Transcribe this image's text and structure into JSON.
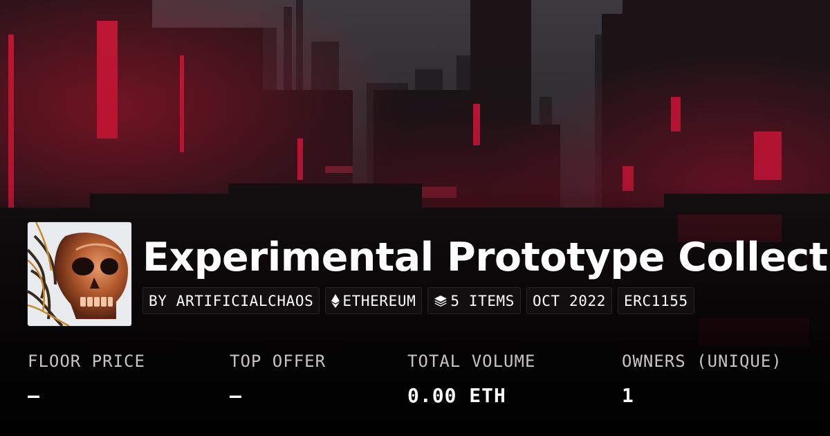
{
  "collection": {
    "title": "Experimental Prototype Collection"
  },
  "tags": [
    {
      "icon": "",
      "label": "BY ARTIFICIALCHAOS"
    },
    {
      "icon": "ethereum-icon",
      "label": "ETHEREUM"
    },
    {
      "icon": "layers-icon",
      "label": "5 ITEMS"
    },
    {
      "icon": "",
      "label": "OCT 2022"
    },
    {
      "icon": "",
      "label": "ERC1155"
    }
  ],
  "stats": [
    {
      "label": "FLOOR PRICE",
      "value": "—"
    },
    {
      "label": "TOP OFFER",
      "value": "—"
    },
    {
      "label": "TOTAL VOLUME",
      "value": "0.00 ETH"
    },
    {
      "label": "OWNERS (UNIQUE)",
      "value": "1"
    }
  ],
  "colors": {
    "accent_red": "#e0183a",
    "background": "#0b0708",
    "label_gray": "#c9c5c6",
    "text": "#ffffff"
  }
}
